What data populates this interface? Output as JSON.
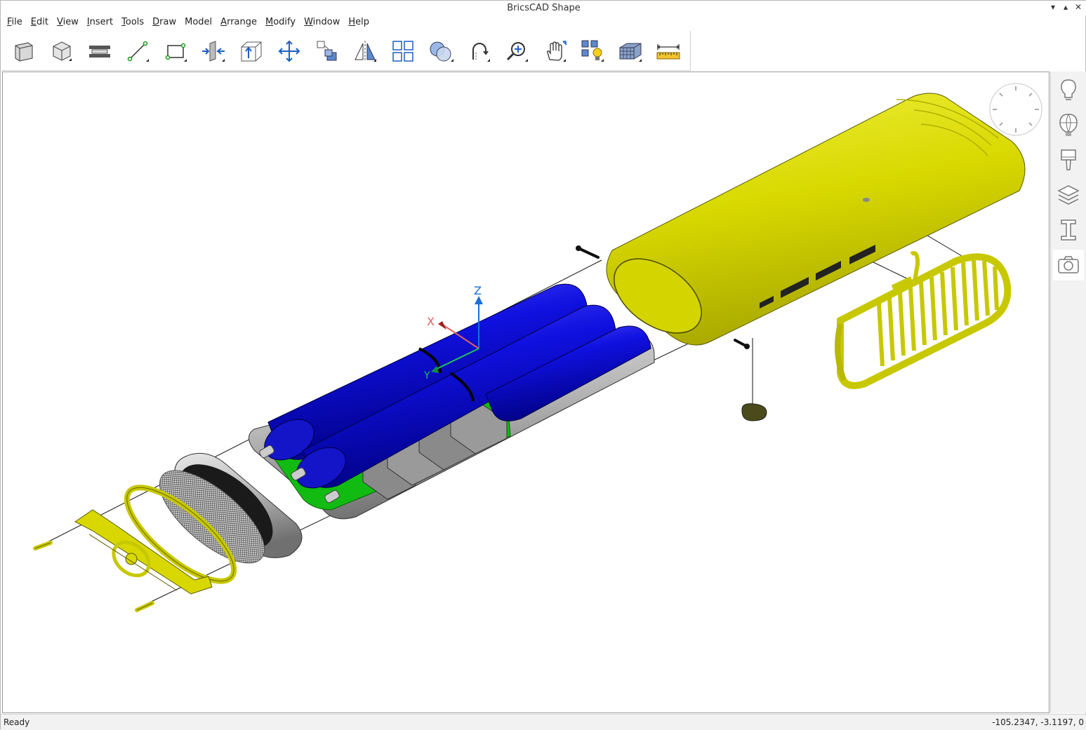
{
  "app": {
    "title": "BricsCAD Shape"
  },
  "menu": [
    {
      "ul": "F",
      "rest": "ile"
    },
    {
      "ul": "E",
      "rest": "dit"
    },
    {
      "ul": "V",
      "rest": "iew"
    },
    {
      "ul": "I",
      "rest": "nsert"
    },
    {
      "ul": "T",
      "rest": "ools"
    },
    {
      "ul": "D",
      "rest": "raw"
    },
    {
      "ul": "",
      "rest": "Model"
    },
    {
      "ul": "A",
      "rest": "rrange"
    },
    {
      "ul": "M",
      "rest": "odify"
    },
    {
      "ul": "W",
      "rest": "indow"
    },
    {
      "ul": "H",
      "rest": "elp"
    }
  ],
  "toolbar_icons": [
    "wall-icon",
    "box-icon",
    "slab-icon",
    "line-icon",
    "rectangle-icon",
    "push-pull-icon",
    "extrude-face-icon",
    "move-icon",
    "copy-icon",
    "mirror-icon",
    "array-icon",
    "boolean-icon",
    "orbit-icon",
    "zoom-icon",
    "pan-icon",
    "view-lights-icon",
    "render-mode-icon",
    "measure-icon"
  ],
  "panel_icons": [
    "tips-icon",
    "materials-icon",
    "paint-icon",
    "layers-icon",
    "components-icon",
    "camera-icon"
  ],
  "viewport": {
    "axis_labels": {
      "z": "Z",
      "x": "X",
      "y": "Y"
    }
  },
  "colors": {
    "yellow": "#d6d600",
    "blue": "#0000dd",
    "green": "#00c000",
    "grey": "#a8a8a8"
  },
  "status": {
    "left": "Ready",
    "right": "-105.2347, -3.1197, 0"
  }
}
